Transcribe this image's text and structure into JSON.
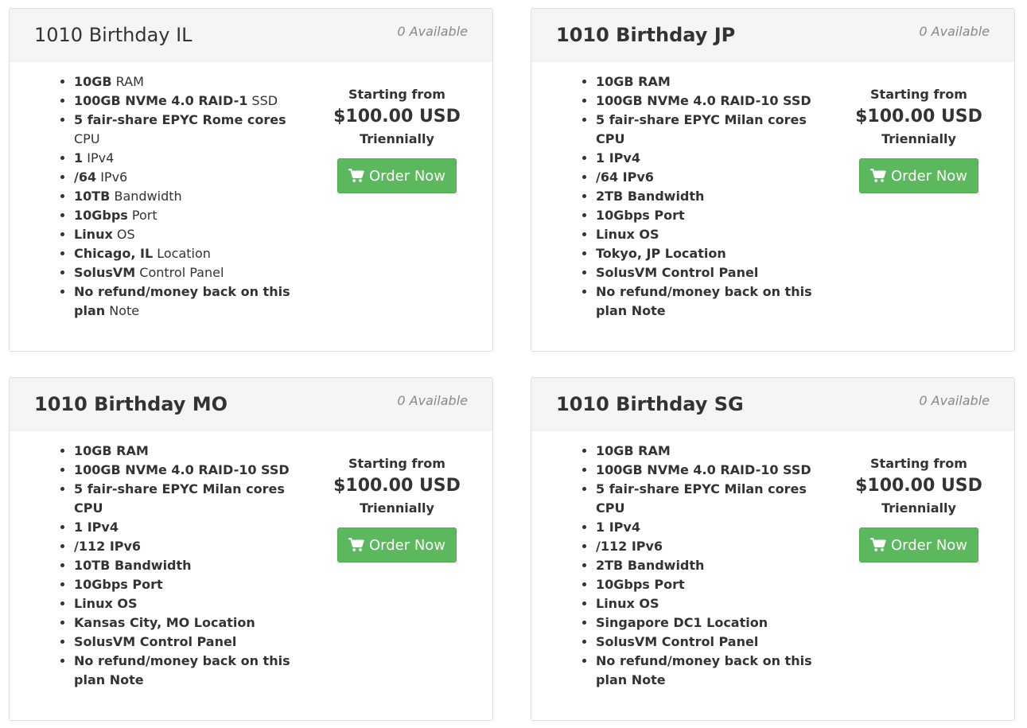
{
  "products": [
    {
      "title": "1010 Birthday IL",
      "available": "0 Available",
      "features": [
        {
          "value": "10GB",
          "label": " RAM"
        },
        {
          "value": "100GB NVMe 4.0 RAID-1",
          "label": " SSD"
        },
        {
          "value": "5 fair-share EPYC Rome cores",
          "label": " CPU"
        },
        {
          "value": "1",
          "label": " IPv4"
        },
        {
          "value": "/64",
          "label": " IPv6"
        },
        {
          "value": "10TB",
          "label": " Bandwidth"
        },
        {
          "value": "10Gbps",
          "label": " Port"
        },
        {
          "value": "Linux",
          "label": " OS"
        },
        {
          "value": "Chicago, IL",
          "label": " Location"
        },
        {
          "value": "SolusVM",
          "label": " Control Panel"
        },
        {
          "value": "No refund/money back on this plan",
          "label": " Note"
        }
      ],
      "starting_from": "Starting from",
      "price": "$100.00 USD",
      "cycle": "Triennially",
      "order_label": "Order Now"
    },
    {
      "title": "1010 Birthday JP",
      "available": "0 Available",
      "features": [
        {
          "value": "10GB",
          "label": " RAM"
        },
        {
          "value": "100GB NVMe 4.0 RAID-10",
          "label": " SSD"
        },
        {
          "value": "5 fair-share EPYC Milan cores",
          "label": " CPU"
        },
        {
          "value": "1",
          "label": " IPv4"
        },
        {
          "value": "/64",
          "label": " IPv6"
        },
        {
          "value": "2TB",
          "label": " Bandwidth"
        },
        {
          "value": "10Gbps",
          "label": " Port"
        },
        {
          "value": "Linux",
          "label": " OS"
        },
        {
          "value": "Tokyo, JP",
          "label": " Location"
        },
        {
          "value": "SolusVM",
          "label": " Control Panel"
        },
        {
          "value": "No refund/money back on this plan",
          "label": " Note"
        }
      ],
      "starting_from": "Starting from",
      "price": "$100.00 USD",
      "cycle": "Triennially",
      "order_label": "Order Now"
    },
    {
      "title": "1010 Birthday MO",
      "available": "0 Available",
      "features": [
        {
          "value": "10GB",
          "label": " RAM"
        },
        {
          "value": "100GB NVMe 4.0 RAID-10",
          "label": " SSD"
        },
        {
          "value": "5 fair-share EPYC Milan cores",
          "label": " CPU"
        },
        {
          "value": "1",
          "label": " IPv4"
        },
        {
          "value": "/112",
          "label": " IPv6"
        },
        {
          "value": "10TB",
          "label": " Bandwidth"
        },
        {
          "value": "10Gbps",
          "label": " Port"
        },
        {
          "value": "Linux",
          "label": " OS"
        },
        {
          "value": "Kansas City, MO",
          "label": " Location"
        },
        {
          "value": "SolusVM",
          "label": " Control Panel"
        },
        {
          "value": "No refund/money back on this plan",
          "label": " Note"
        }
      ],
      "starting_from": "Starting from",
      "price": "$100.00 USD",
      "cycle": "Triennially",
      "order_label": "Order Now"
    },
    {
      "title": "1010 Birthday SG",
      "available": "0 Available",
      "features": [
        {
          "value": "10GB",
          "label": " RAM"
        },
        {
          "value": "100GB NVMe 4.0 RAID-10",
          "label": " SSD"
        },
        {
          "value": "5 fair-share EPYC Milan cores",
          "label": " CPU"
        },
        {
          "value": "1",
          "label": " IPv4"
        },
        {
          "value": "/112",
          "label": " IPv6"
        },
        {
          "value": "2TB",
          "label": " Bandwidth"
        },
        {
          "value": "10Gbps",
          "label": " Port"
        },
        {
          "value": "Linux",
          "label": " OS"
        },
        {
          "value": "Singapore DC1",
          "label": " Location"
        },
        {
          "value": "SolusVM",
          "label": " Control Panel"
        },
        {
          "value": "No refund/money back on this plan",
          "label": " Note"
        }
      ],
      "starting_from": "Starting from",
      "price": "$100.00 USD",
      "cycle": "Triennially",
      "order_label": "Order Now"
    }
  ],
  "icons": {
    "order_button": "shopping-cart-icon"
  },
  "colors": {
    "order_button": "#5cb85c",
    "header_bg": "#f5f5f5",
    "available_text": "#888888"
  }
}
